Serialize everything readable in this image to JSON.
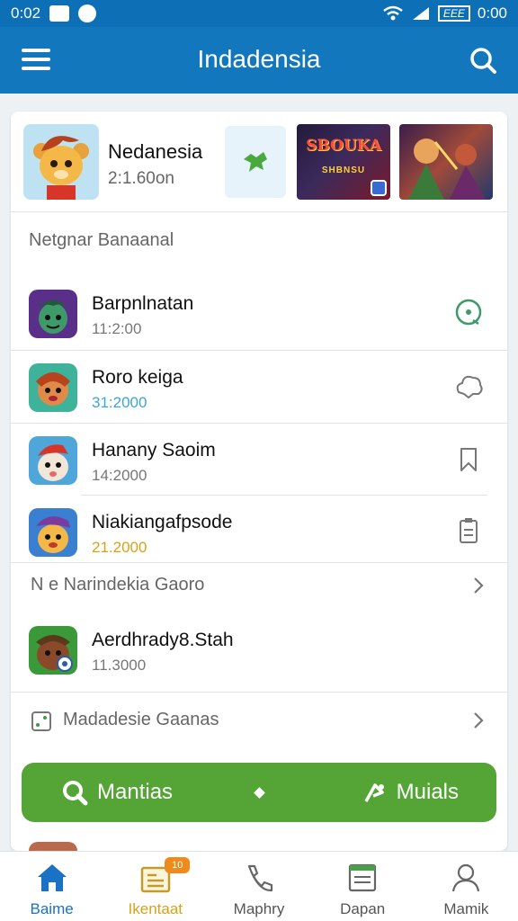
{
  "status_bar": {
    "time": "0:02",
    "right_time": "0:00",
    "battery_label": "EEE"
  },
  "app_bar": {
    "title": "Indadensia"
  },
  "featured": {
    "title": "Nedanesia",
    "subtitle": "2:1.60on",
    "thumb1_title": "SBOUKA",
    "thumb1_sub": "SHBNSU"
  },
  "section_title": "Netgnar Banaanal",
  "list": [
    {
      "name": "Barpnlnatan",
      "sub": "11:2:00",
      "sub_color": "#777777",
      "icon": "clock-icon"
    },
    {
      "name": "Roro keiga",
      "sub": "31:2000",
      "sub_color": "#3aa5d8",
      "icon": "cloud-icon"
    },
    {
      "name": "Hanany Saoim",
      "sub": "14:2000",
      "sub_color": "#777777",
      "icon": "bookmark-icon"
    },
    {
      "name": "Niakiangafpsode",
      "sub": "21.2000",
      "sub_color": "#d6a21a",
      "icon": "document-icon"
    }
  ],
  "link1": "N e Narindekia Gaoro",
  "list2": [
    {
      "name": "Aerdhrady8.Stah",
      "sub": "11.3000"
    }
  ],
  "link2": "Madadesie Gaanas",
  "cta": {
    "left_label": "Mantias",
    "right_label": "Muials"
  },
  "bottom_nav": [
    {
      "label": "Baime",
      "icon": "home-icon"
    },
    {
      "label": "Ikentaat",
      "icon": "news-icon",
      "badge": "10"
    },
    {
      "label": "Maphry",
      "icon": "phone-icon"
    },
    {
      "label": "Dapan",
      "icon": "list-icon"
    },
    {
      "label": "Mamik",
      "icon": "user-icon"
    }
  ],
  "colors": {
    "app_bar": "#1377be",
    "accent_green": "#55a536",
    "active_nav": "#1a72c4",
    "highlight": "#d6a21a"
  }
}
